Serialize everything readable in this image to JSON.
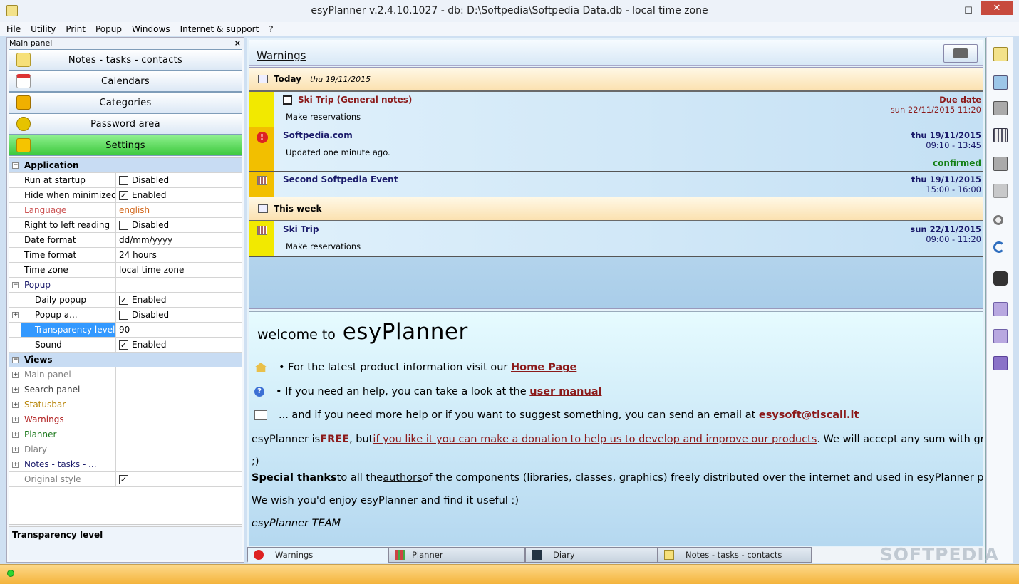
{
  "window": {
    "title": "esyPlanner v.2.4.10.1027 - db: D:\\Softpedia\\Softpedia Data.db - local time zone",
    "min": "—",
    "max": "☐",
    "close": "✕"
  },
  "menu": [
    "File",
    "Utility",
    "Print",
    "Popup",
    "Windows",
    "Internet & support",
    "?"
  ],
  "left_panel": {
    "title": "Main panel",
    "close": "×",
    "nav": [
      {
        "label": "Notes - tasks - contacts",
        "icon": "note-icon"
      },
      {
        "label": "Calendars",
        "icon": "calendar-icon"
      },
      {
        "label": "Categories",
        "icon": "categories-icon"
      },
      {
        "label": "Password area",
        "icon": "lock-icon"
      },
      {
        "label": "Settings",
        "icon": "puzzle-icon"
      }
    ],
    "properties": [
      {
        "type": "cat",
        "name": "Application",
        "expander": "−"
      },
      {
        "type": "row",
        "name": "Run at startup",
        "checked": false,
        "value": "Disabled"
      },
      {
        "type": "row",
        "name": "Hide when minimized",
        "checked": true,
        "value": "Enabled"
      },
      {
        "type": "row",
        "name": "Language",
        "value": "english",
        "color": "#cc5555"
      },
      {
        "type": "row",
        "name": "Right to left reading",
        "checked": false,
        "value": "Disabled"
      },
      {
        "type": "row",
        "name": "Date format",
        "value": "dd/mm/yyyy"
      },
      {
        "type": "row",
        "name": "Time format",
        "value": "24 hours"
      },
      {
        "type": "row",
        "name": "Time zone",
        "value": "local time zone"
      },
      {
        "type": "sub",
        "name": "Popup",
        "expander": "−",
        "color": "#1a1a6a"
      },
      {
        "type": "row",
        "name": "Daily popup",
        "checked": true,
        "value": "Enabled",
        "indent": true
      },
      {
        "type": "row",
        "name": "Popup a...",
        "checked": false,
        "value": "Disabled",
        "indent": true,
        "expander": "+"
      },
      {
        "type": "row",
        "name": "Transparency level",
        "value": "90",
        "indent": true,
        "selected": true
      },
      {
        "type": "row",
        "name": "Sound",
        "checked": true,
        "value": "Enabled",
        "indent": true
      },
      {
        "type": "cat",
        "name": "Views",
        "expander": "−"
      },
      {
        "type": "row",
        "name": "Main panel",
        "expander": "+",
        "color": "#808080"
      },
      {
        "type": "row",
        "name": "Search panel",
        "expander": "+",
        "color": "#404040"
      },
      {
        "type": "row",
        "name": "Statusbar",
        "expander": "+",
        "color": "#b8860b"
      },
      {
        "type": "row",
        "name": "Warnings",
        "expander": "+",
        "color": "#b22222"
      },
      {
        "type": "row",
        "name": "Planner",
        "expander": "+",
        "color": "#1e7a1e"
      },
      {
        "type": "row",
        "name": "Diary",
        "expander": "+",
        "color": "#808080"
      },
      {
        "type": "row",
        "name": "Notes - tasks - ...",
        "expander": "+",
        "color": "#1a1a6a"
      },
      {
        "type": "row",
        "name": "Original style",
        "checked": true,
        "value": "",
        "color": "#808080"
      }
    ],
    "description": "Transparency level"
  },
  "warnings": {
    "title": "Warnings",
    "groups": [
      {
        "label": "Today",
        "date": "thu 19/11/2015",
        "events": [
          {
            "title": "Ski Trip (General notes)",
            "sub": "Make reservations",
            "right1": "Due date",
            "right2": "sun 22/11/2015 11:20",
            "kind": "task"
          },
          {
            "title": "Softpedia.com",
            "sub": "Updated one minute ago.",
            "right1": "thu 19/11/2015",
            "right2": "09:10 - 13:45",
            "confirmed": "confirmed",
            "kind": "alert"
          },
          {
            "title": "Second Softpedia Event",
            "sub": "",
            "right1": "thu 19/11/2015",
            "right2": "15:00 - 16:00",
            "kind": "cal"
          }
        ]
      },
      {
        "label": "This week",
        "date": "",
        "events": [
          {
            "title": "Ski Trip",
            "sub": "Make reservations",
            "right1": "sun 22/11/2015",
            "right2": "09:00 - 11:20",
            "kind": "cal"
          }
        ]
      }
    ]
  },
  "welcome": {
    "w1": "welcome to",
    "w2": "esyPlanner",
    "l1_pre": "• For the latest product information visit our",
    "l1_link": "Home Page",
    "l2_pre": "• If you need an help, you can take a look at the",
    "l2_link": "user manual",
    "l3_pre": "... and if you need more help or if you want to suggest something, you can send an email at",
    "l3_link": "esysoft@tiscali.it",
    "l4_a": "esyPlanner is ",
    "l4_free": "FREE",
    "l4_b": ", but ",
    "l4_link": "if you like it you can make a donation to help us to develop and improve our products",
    "l4_c": ". We will accept any sum with gratitude",
    "l4_d": ";)",
    "l5_bold": "Special thanks",
    "l5_a": " to all the ",
    "l5_link": "authors",
    "l5_b": " of the components (libraries, classes, graphics) freely distributed over the internet and used in esyPlanner project.",
    "l6": "We wish you'd enjoy esyPlanner and find it useful :)",
    "l7": "esyPlanner TEAM"
  },
  "tabs": [
    {
      "label": "Warnings",
      "icon": "warning-icon",
      "active": true
    },
    {
      "label": "Planner",
      "icon": "planner-icon"
    },
    {
      "label": "Diary",
      "icon": "diary-icon"
    },
    {
      "label": "Notes - tasks - contacts",
      "icon": "notes-icon"
    }
  ],
  "watermark": "SOFTPEDIA"
}
